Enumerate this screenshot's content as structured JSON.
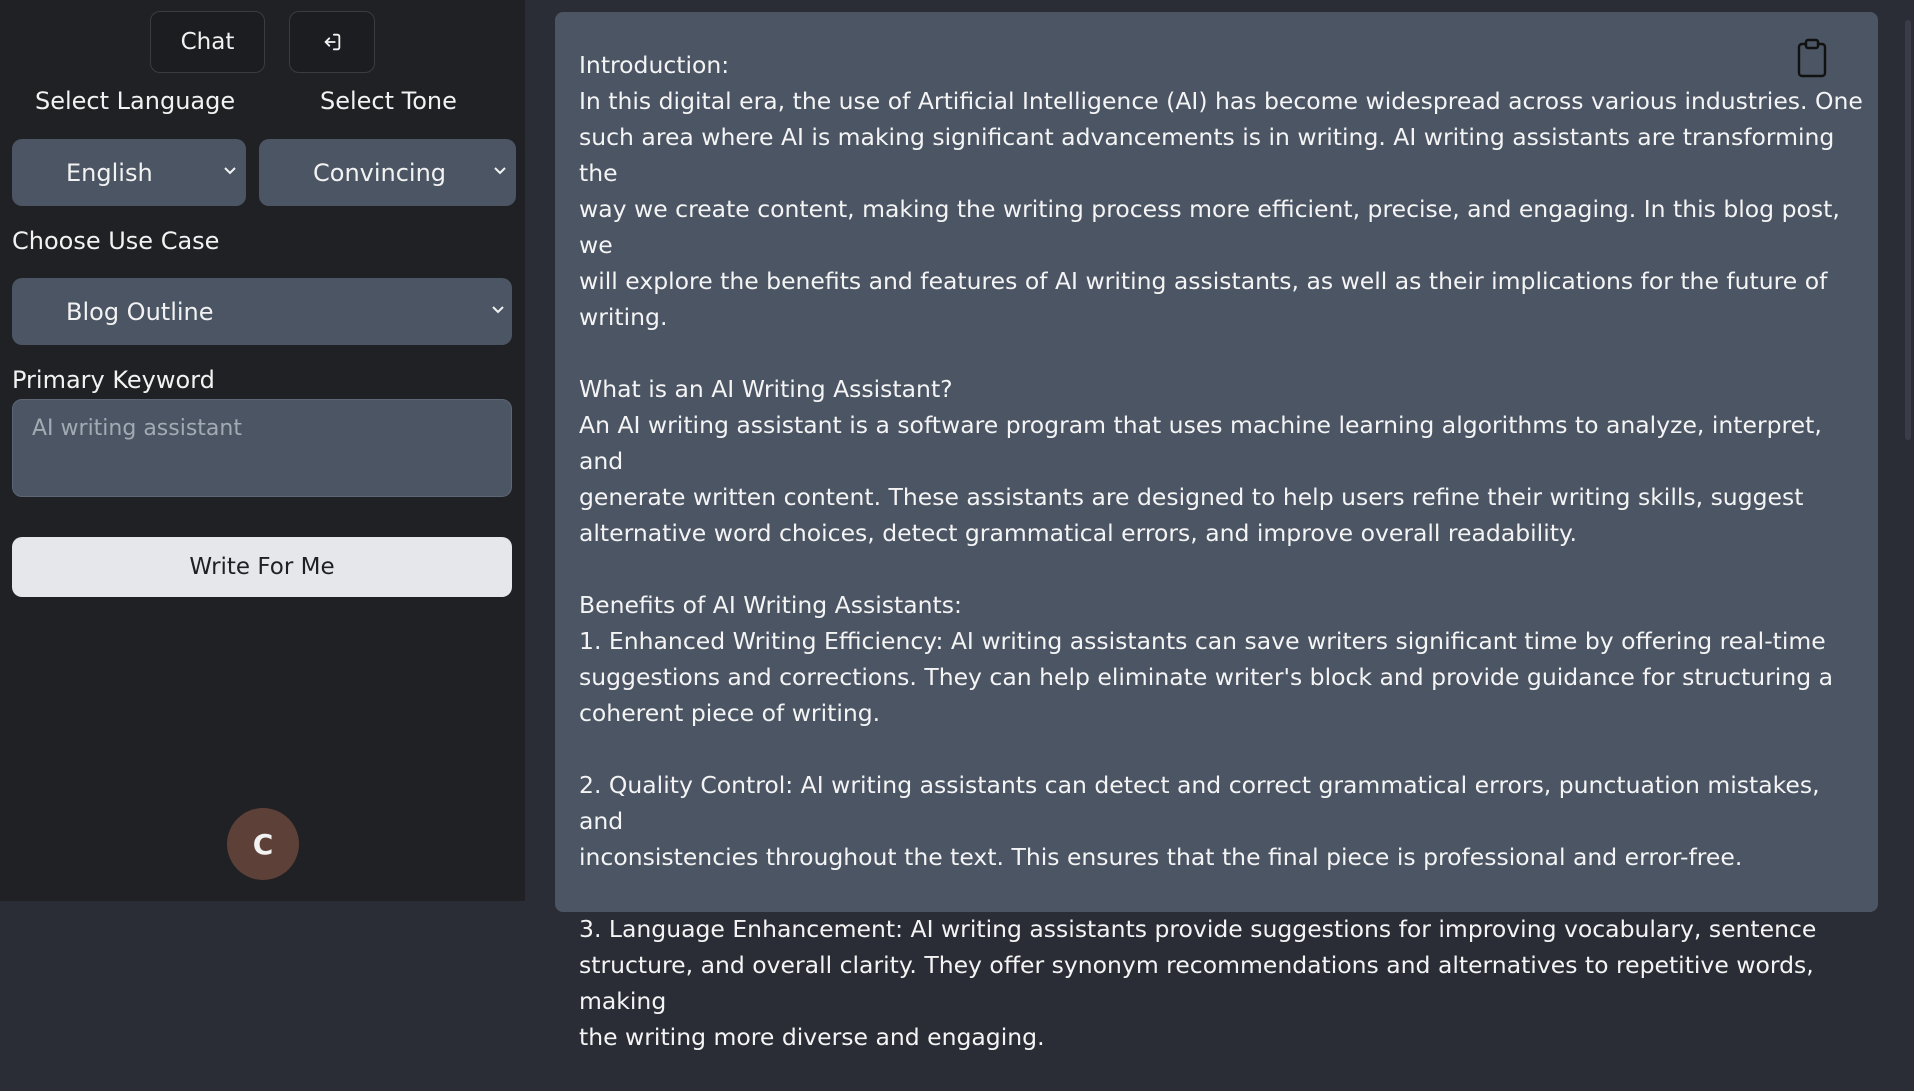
{
  "sidebar": {
    "chat_label": "Chat",
    "select_language_label": "Select Language",
    "select_tone_label": "Select Tone",
    "language_value": "English",
    "tone_value": "Convincing",
    "use_case_label": "Choose Use Case",
    "use_case_value": "Blog Outline",
    "keyword_label": "Primary Keyword",
    "keyword_placeholder": "AI writing assistant",
    "write_button": "Write For Me",
    "avatar_initial": "C"
  },
  "output": {
    "paragraphs": [
      [
        "Introduction:",
        "In this digital era, the use of Artificial Intelligence (AI) has become widespread across various industries. One",
        "such area where AI is making significant advancements is in writing. AI writing assistants are transforming the",
        "way we create content, making the writing process more efficient, precise, and engaging. In this blog post, we",
        "will explore the benefits and features of AI writing assistants, as well as their implications for the future of",
        "writing."
      ],
      [
        "What is an AI Writing Assistant?",
        "An AI writing assistant is a software program that uses machine learning algorithms to analyze, interpret, and",
        "generate written content. These assistants are designed to help users refine their writing skills, suggest",
        "alternative word choices, detect grammatical errors, and improve overall readability."
      ],
      [
        "Benefits of AI Writing Assistants:",
        "1. Enhanced Writing Efficiency: AI writing assistants can save writers significant time by offering real-time",
        "suggestions and corrections. They can help eliminate writer's block and provide guidance for structuring a",
        "coherent piece of writing."
      ],
      [
        "2. Quality Control: AI writing assistants can detect and correct grammatical errors, punctuation mistakes, and",
        "inconsistencies throughout the text. This ensures that the final piece is professional and error-free."
      ],
      [
        "3. Language Enhancement: AI writing assistants provide suggestions for improving vocabulary, sentence",
        "structure, and overall clarity. They offer synonym recommendations and alternatives to repetitive words, making",
        "the writing more diverse and engaging."
      ]
    ]
  }
}
